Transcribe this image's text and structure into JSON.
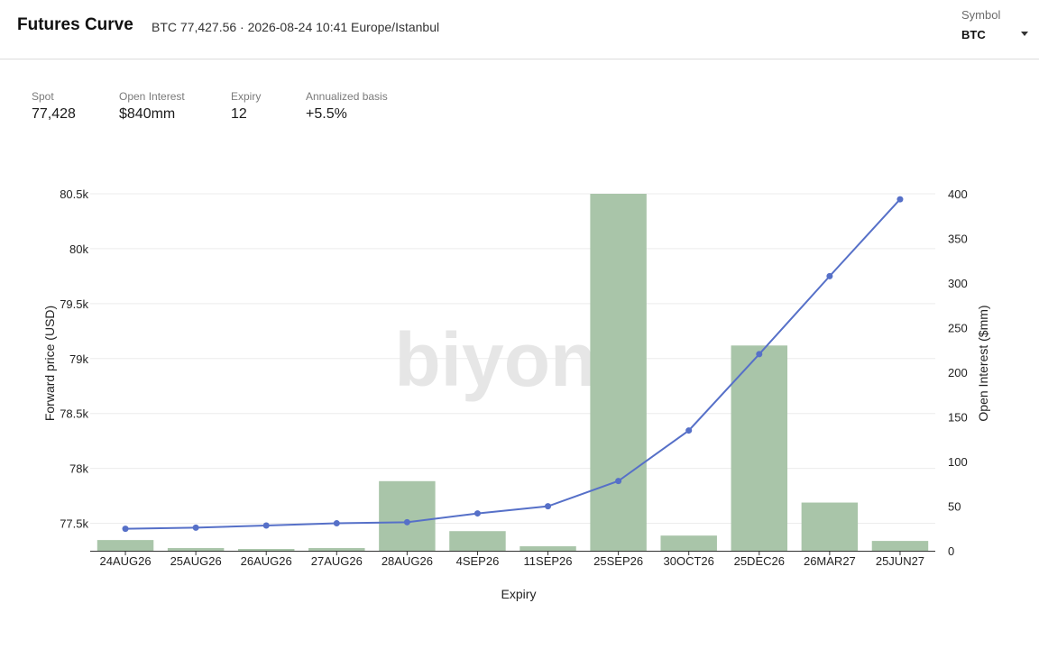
{
  "header": {
    "title": "Futures Curve",
    "subtitle": "BTC 77,427.56 · 2026-08-24 10:41 Europe/Istanbul",
    "symbol_label": "Symbol",
    "symbol_value": "BTC"
  },
  "stats": [
    {
      "label": "Spot",
      "value": "77,428"
    },
    {
      "label": "Open Interest",
      "value": "$840mm"
    },
    {
      "label": "Expiry",
      "value": "12"
    },
    {
      "label": "Annualized basis",
      "value": "+5.5%"
    }
  ],
  "watermark": "biyond",
  "colors": {
    "bar": "#a9c5a9",
    "line": "#5670c8",
    "grid": "#ececec"
  },
  "chart_data": {
    "type": "bar",
    "categories": [
      "24AUG26",
      "25AUG26",
      "26AUG26",
      "27AUG26",
      "28AUG26",
      "4SEP26",
      "11SEP26",
      "25SEP26",
      "30OCT26",
      "25DEC26",
      "26MAR27",
      "25JUN27"
    ],
    "xlabel": "Expiry",
    "y_left_label": "Forward price (USD)",
    "y_right_label": "Open Interest ($mm)",
    "y_left_lim": [
      77250,
      80500
    ],
    "y_right_lim": [
      0,
      400
    ],
    "y_left_ticks": [
      77500,
      78000,
      78500,
      79000,
      79500,
      80000,
      80500
    ],
    "y_left_tick_labels": [
      "77.5k",
      "78k",
      "78.5k",
      "79k",
      "79.5k",
      "80k",
      "80.5k"
    ],
    "y_right_ticks": [
      0,
      50,
      100,
      150,
      200,
      250,
      300,
      350,
      400
    ],
    "grid": true,
    "series": [
      {
        "type": "bar",
        "axis": "right",
        "values": [
          12,
          3,
          2,
          3,
          78,
          22,
          5,
          400,
          17,
          230,
          54,
          11
        ]
      },
      {
        "type": "line",
        "axis": "left",
        "values": [
          77450,
          77460,
          77480,
          77500,
          77510,
          77590,
          77655,
          77885,
          78345,
          79040,
          79750,
          80450
        ]
      }
    ]
  }
}
